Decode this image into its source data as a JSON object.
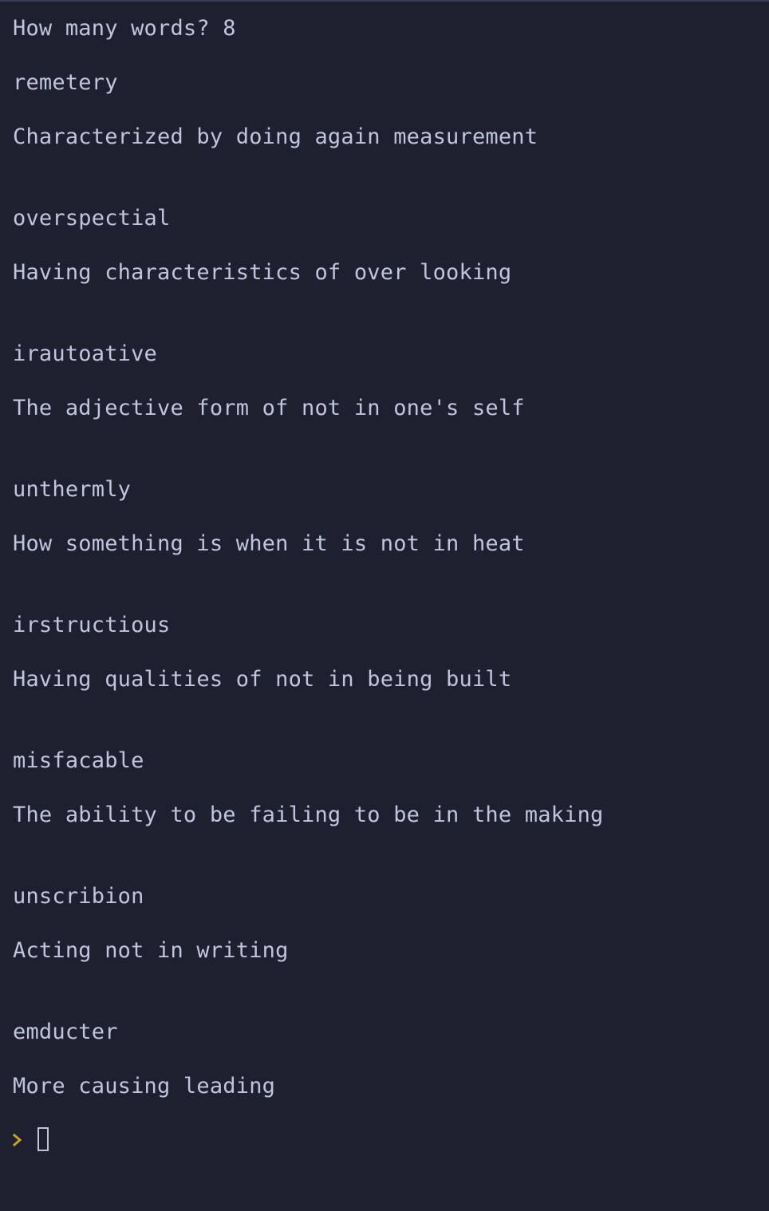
{
  "terminal": {
    "question": "How many words? 8",
    "entries": [
      {
        "word": "remetery",
        "definition": "Characterized by doing again measurement"
      },
      {
        "word": "overspectial",
        "definition": "Having characteristics of over looking"
      },
      {
        "word": "irautoative",
        "definition": "The adjective form of not in one's self"
      },
      {
        "word": "unthermly",
        "definition": "How something is when it is not in heat"
      },
      {
        "word": "irstructious",
        "definition": "Having qualities of not in being built"
      },
      {
        "word": "misfacable",
        "definition": "The ability to be failing to be in the making"
      },
      {
        "word": "unscribion",
        "definition": "Acting not in writing"
      },
      {
        "word": "emducter",
        "definition": "More causing leading"
      }
    ],
    "prompt_symbol": "›",
    "prompt_color": "#c9a227",
    "background": "#1e2030",
    "text_color": "#c0c5de"
  }
}
